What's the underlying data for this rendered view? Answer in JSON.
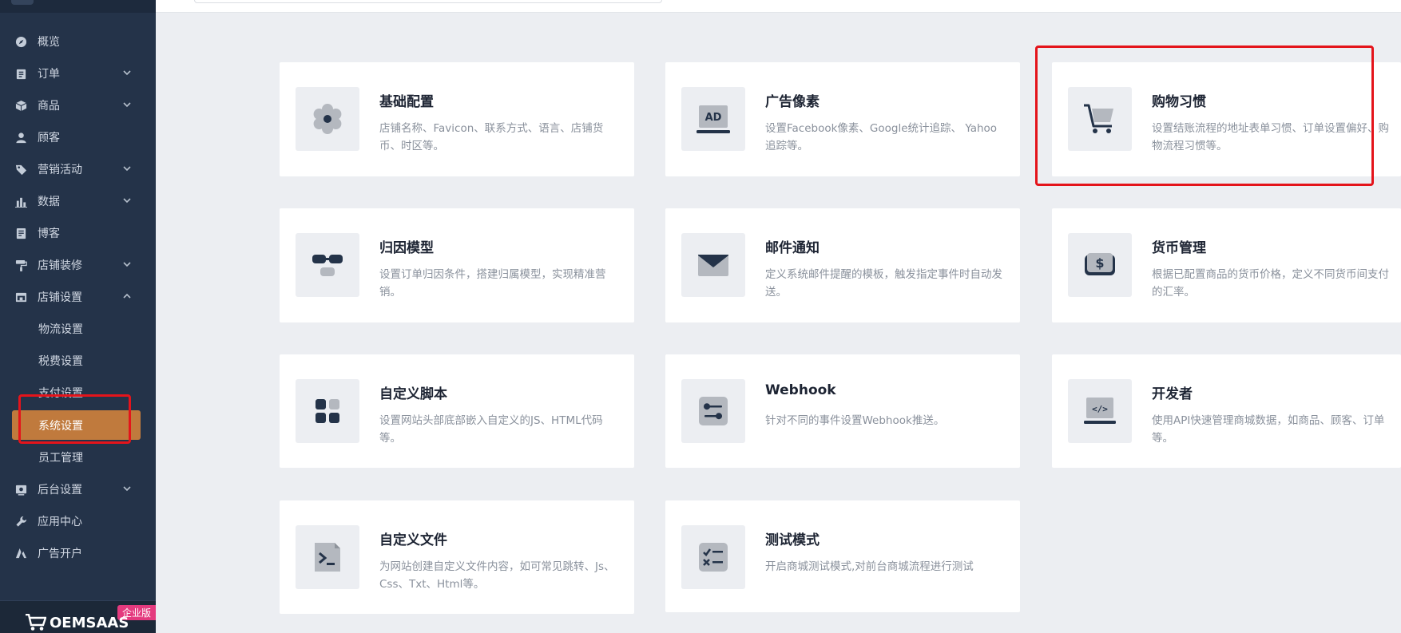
{
  "sidebar": {
    "items": [
      {
        "label": "概览",
        "icon": "dashboard-icon"
      },
      {
        "label": "订单",
        "icon": "order-icon"
      },
      {
        "label": "商品",
        "icon": "product-icon"
      },
      {
        "label": "顾客",
        "icon": "user-icon"
      },
      {
        "label": "营销活动",
        "icon": "tag-icon"
      },
      {
        "label": "数据",
        "icon": "chart-icon"
      },
      {
        "label": "博客",
        "icon": "blog-icon"
      },
      {
        "label": "店铺装修",
        "icon": "brush-icon"
      },
      {
        "label": "店铺设置",
        "icon": "store-icon"
      },
      {
        "label": "后台设置",
        "icon": "admin-icon"
      },
      {
        "label": "应用中心",
        "icon": "wrench-icon"
      },
      {
        "label": "广告开户",
        "icon": "ads-icon"
      }
    ],
    "sub_items": [
      "物流设置",
      "税费设置",
      "支付设置",
      "系统设置",
      "员工管理"
    ],
    "brand": "OEMSAAS",
    "edition_badge": "企业版"
  },
  "cards": [
    {
      "title": "基础配置",
      "desc": "店铺名称、Favicon、联系方式、语言、店铺货币、时区等。",
      "icon": "gear-icon"
    },
    {
      "title": "广告像素",
      "desc": "设置Facebook像素、Google统计追踪、 Yahoo追踪等。",
      "icon": "ad-pixel-icon",
      "icon_text": "AD"
    },
    {
      "title": "购物习惯",
      "desc": "设置结账流程的地址表单习惯、订单设置偏好、购物流程习惯等。",
      "icon": "cart-icon"
    },
    {
      "title": "归因模型",
      "desc": "设置订单归因条件，搭建归属模型，实现精准营销。",
      "icon": "attribution-icon"
    },
    {
      "title": "邮件通知",
      "desc": "定义系统邮件提醒的模板，触发指定事件时自动发送。",
      "icon": "mail-icon"
    },
    {
      "title": "货币管理",
      "desc": "根据已配置商品的货币价格，定义不同货币间支付的汇率。",
      "icon": "currency-icon",
      "icon_text": "$"
    },
    {
      "title": "自定义脚本",
      "desc": "设置网站头部底部嵌入自定义的JS、HTML代码等。",
      "icon": "script-icon"
    },
    {
      "title": "Webhook",
      "desc": "针对不同的事件设置Webhook推送。",
      "icon": "webhook-icon"
    },
    {
      "title": "开发者",
      "desc": "使用API快速管理商城数据，如商品、顾客、订单等。",
      "icon": "developer-icon",
      "icon_text": "</>"
    },
    {
      "title": "自定义文件",
      "desc": "为网站创建自定义文件内容，如可常见跳转、Js、Css、Txt、Html等。",
      "icon": "terminal-file-icon"
    },
    {
      "title": "测试模式",
      "desc": "开启商城测试模式,对前台商城流程进行测试",
      "icon": "test-mode-icon"
    }
  ],
  "colors": {
    "sidebar_bg": "#243349",
    "active_item": "#c07a3d",
    "highlight_red": "#e4141b",
    "edition_badge": "#e43a7e",
    "page_bg": "#eceef2"
  }
}
